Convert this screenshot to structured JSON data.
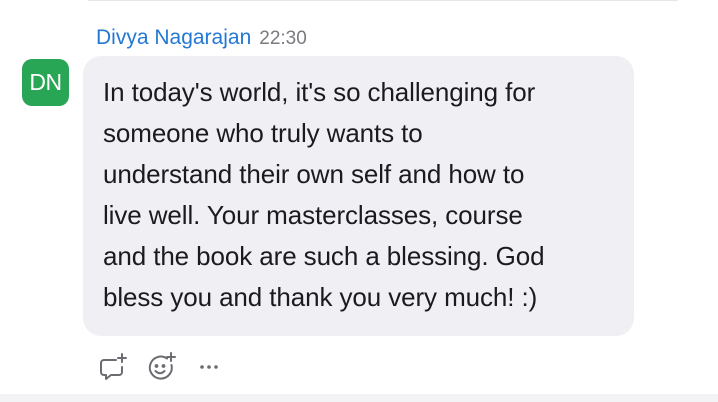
{
  "message": {
    "avatar_initials": "DN",
    "avatar_color": "#29a556",
    "author": "Divya Nagarajan",
    "author_color": "#2478d4",
    "timestamp": "22:30",
    "lines": [
      "In today's world, it's so challenging for",
      "someone who truly wants to",
      "understand their own self and how to",
      "live well. Your masterclasses, course",
      "and the book are such a blessing. God",
      "bless you and thank you very much! :)"
    ],
    "bubble_color": "#f0f0f4"
  },
  "actions": [
    {
      "icon": "comment-add-icon"
    },
    {
      "icon": "emoji-add-icon"
    },
    {
      "icon": "more-options-icon"
    }
  ]
}
